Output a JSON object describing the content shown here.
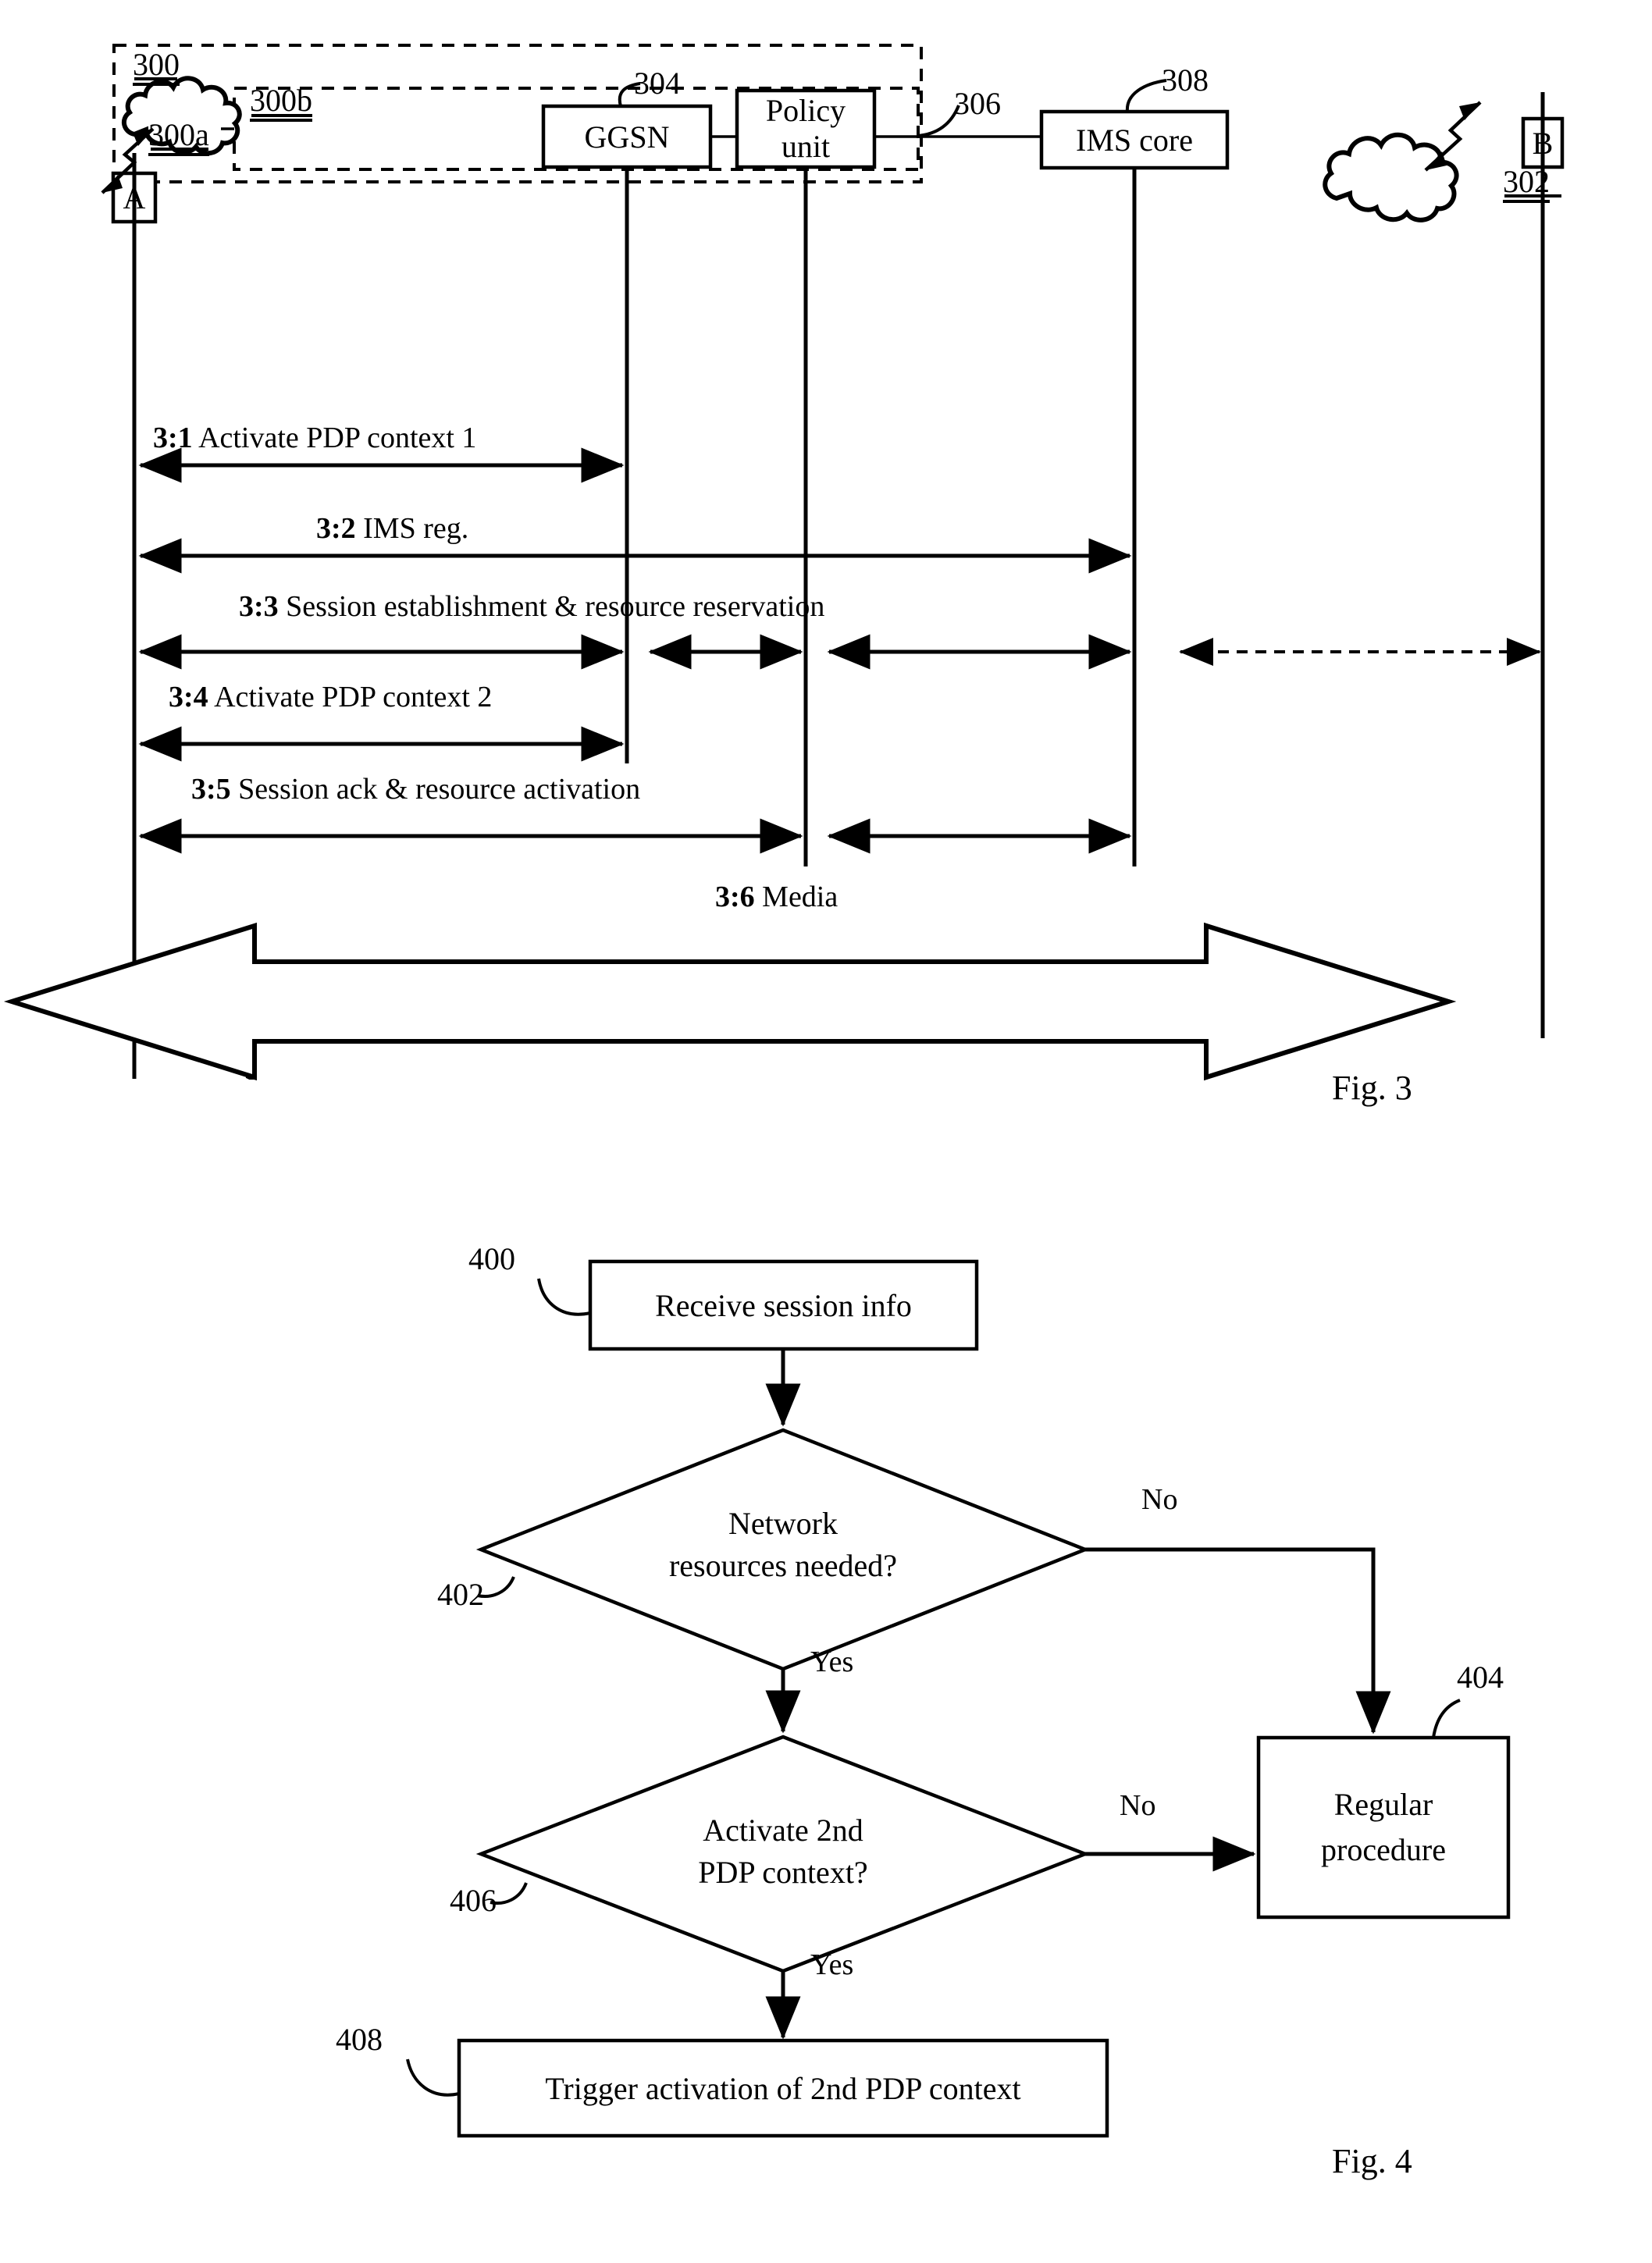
{
  "figure3": {
    "caption": "Fig. 3",
    "refs": {
      "net_300": "300",
      "cloud_300a": "300a",
      "inner_300b": "300b",
      "ggsn_304": "304",
      "policy_306": "306",
      "ims_308": "308",
      "cloud_302": "302"
    },
    "nodes": {
      "a": "A",
      "b": "B",
      "ggsn": "GGSN",
      "policy_line1": "Policy",
      "policy_line2": "unit",
      "ims": "IMS core"
    },
    "messages": [
      {
        "num": "3:1",
        "text": "Activate PDP context 1"
      },
      {
        "num": "3:2",
        "text": "IMS reg."
      },
      {
        "num": "3:3",
        "text": "Session establishment & resource reservation"
      },
      {
        "num": "3:4",
        "text": "Activate PDP context 2"
      },
      {
        "num": "3:5",
        "text": "Session ack & resource activation"
      },
      {
        "num": "3:6",
        "text": "Media"
      }
    ]
  },
  "figure4": {
    "caption": "Fig. 4",
    "refs": {
      "start_400": "400",
      "decision_402": "402",
      "regular_404": "404",
      "decision_406": "406",
      "trigger_408": "408"
    },
    "steps": {
      "receive": "Receive session info",
      "decision1_line1": "Network",
      "decision1_line2": "resources needed?",
      "decision2_line1": "Activate 2nd",
      "decision2_line2": "PDP context?",
      "regular_line1": "Regular",
      "regular_line2": "procedure",
      "trigger": "Trigger activation of 2nd PDP context"
    },
    "branch_labels": {
      "no1": "No",
      "yes1": "Yes",
      "no2": "No",
      "yes2": "Yes"
    }
  },
  "colors": {
    "ink": "#000000",
    "paper": "#ffffff"
  }
}
